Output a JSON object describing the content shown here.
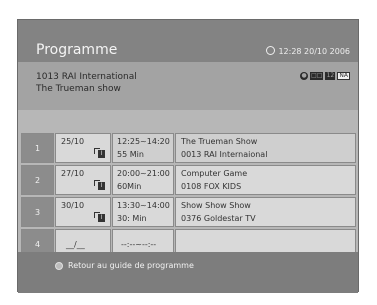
{
  "screen": {
    "title": "Programme",
    "clock": "12:28 20/10 2006"
  },
  "current": {
    "channel": "1013 RAI International",
    "programme": "The Trueman show",
    "badges": [
      "●",
      "□□",
      "12",
      "NA"
    ]
  },
  "reminders": [
    {
      "index": "1",
      "date": "25/10",
      "time": "12:25~14:20",
      "duration": "55 Min",
      "programme": "The Trueman Show",
      "channel": "0013 RAI Internaional",
      "subtitle_icon": "I"
    },
    {
      "index": "2",
      "date": "27/10",
      "time": "20:00~21:00",
      "duration": "60Min",
      "programme": "Computer Game",
      "channel": "0108 FOX KIDS",
      "subtitle_icon": "I"
    },
    {
      "index": "3",
      "date": "30/10",
      "time": "13:30~14:00",
      "duration": "30: Min",
      "programme": "Show Show Show",
      "channel": "0376 Goldestar TV",
      "subtitle_icon": "I"
    },
    {
      "index": "4",
      "date": "__/__",
      "time": "--:--~--:--",
      "duration": "",
      "programme": "",
      "channel": "",
      "subtitle_icon": ""
    }
  ],
  "footer": {
    "hint": "Retour au guide de programme"
  }
}
